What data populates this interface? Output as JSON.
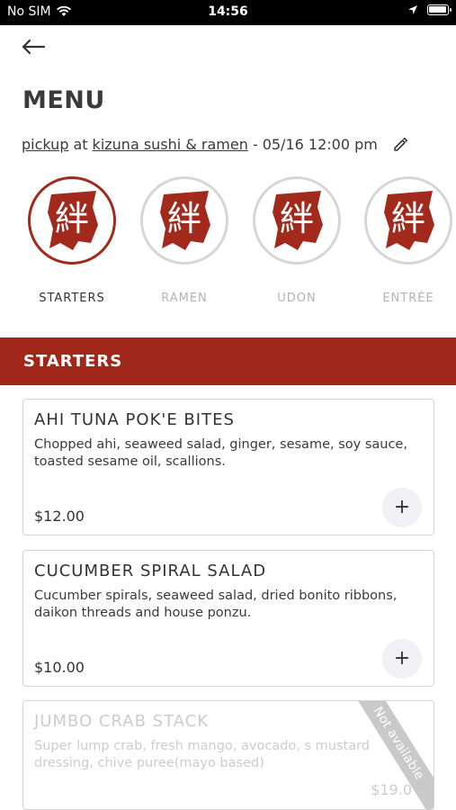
{
  "status_bar": {
    "carrier": "No SIM",
    "time": "14:56"
  },
  "header": {
    "title": "MENU"
  },
  "order": {
    "mode": "pickup",
    "connector": "at",
    "restaurant": "kizuna sushi & ramen",
    "datetime": "- 05/16 12:00 pm"
  },
  "categories": [
    {
      "label": "STARTERS",
      "active": true
    },
    {
      "label": "RAMEN",
      "active": false
    },
    {
      "label": "UDON",
      "active": false
    },
    {
      "label": "ENTRÉE",
      "active": false
    }
  ],
  "logo_glyph": "絆",
  "section": {
    "title": "STARTERS"
  },
  "items": [
    {
      "name": "AHI TUNA POK'E BITES",
      "description": "Chopped ahi, seaweed salad, ginger, sesame, soy sauce, toasted sesame oil, scallions.",
      "price": "$12.00",
      "add_label": "+"
    },
    {
      "name": "CUCUMBER SPIRAL SALAD",
      "description": "Cucumber spirals, seaweed salad, dried bonito ribbons, daikon threads and house ponzu.",
      "price": "$10.00",
      "add_label": "+"
    },
    {
      "name": "JUMBO CRAB STACK",
      "description": "Super lump crab, fresh mango, avocado, s mustard dressing, chive puree(mayo based)",
      "price": "$19.0",
      "badge": "Not available"
    }
  ],
  "colors": {
    "brand": "#a0271a",
    "muted": "#cccccc"
  }
}
